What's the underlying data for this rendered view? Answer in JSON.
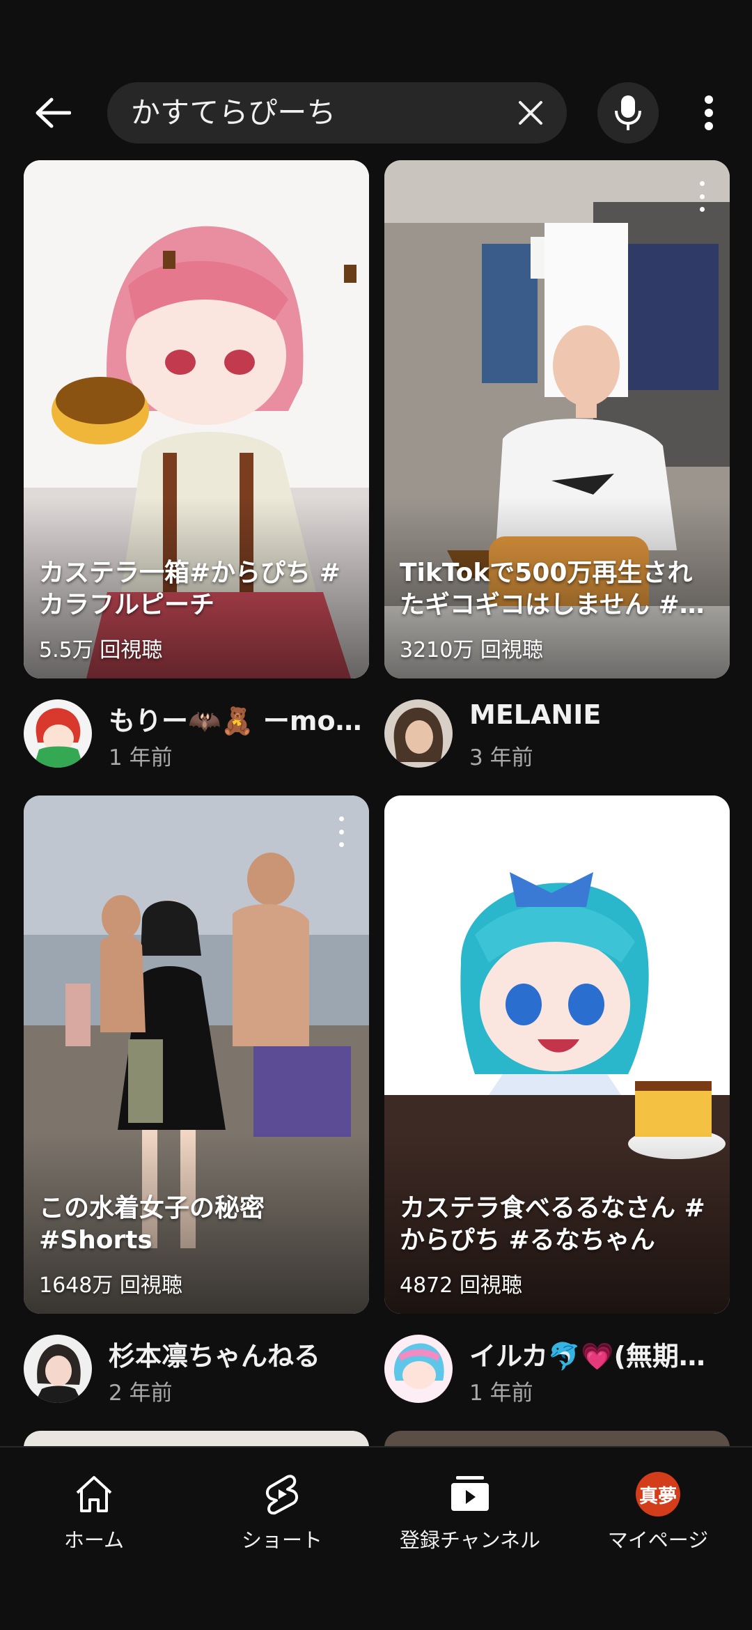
{
  "search": {
    "query": "かすてらぴーち",
    "back_icon": "arrow-left-icon",
    "clear_icon": "close-icon",
    "mic_icon": "microphone-icon",
    "more_icon": "more-vertical-icon"
  },
  "results": [
    {
      "title": "カステラ一箱#からぴち #カラフルピーチ",
      "views": "5.5万 回視聴",
      "channel": "もりー🦇🧸 ーmori…",
      "age": "1 年前"
    },
    {
      "title": "TikTokで500万再生されたギコギコはしません #…",
      "views": "3210万 回視聴",
      "channel": "MELANIE",
      "age": "3 年前"
    },
    {
      "title": "この水着女子の秘密 #Shorts",
      "views": "1648万 回視聴",
      "channel": "杉本凛ちゃんねる",
      "age": "2 年前"
    },
    {
      "title": "カステラ食べるるなさん #からぴち #るなちゃん",
      "views": "4872 回視聴",
      "channel": "イルカ🐬💗(無期限…",
      "age": "1 年前"
    }
  ],
  "nav": {
    "home": "ホーム",
    "shorts": "ショート",
    "subscriptions": "登録チャンネル",
    "mypage": "マイページ",
    "profile_initial": "真夢"
  },
  "colors": {
    "background": "#0f0f0f",
    "surface": "#272727",
    "secondary_text": "#aaaaaa",
    "profile_badge": "#d43d1a"
  }
}
